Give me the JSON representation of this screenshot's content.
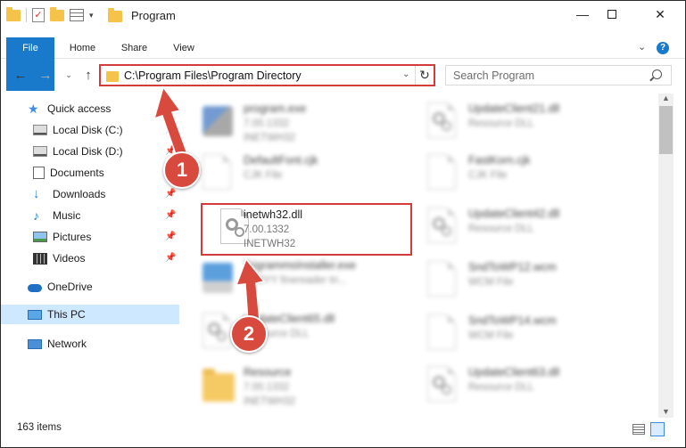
{
  "window": {
    "title": "Program",
    "minimize_glyph": "—",
    "close_glyph": "✕"
  },
  "qat": {
    "check_glyph": "✓",
    "caret": "▾"
  },
  "ribbon": {
    "tabs": [
      "File",
      "Home",
      "Share",
      "View"
    ],
    "expand_glyph": "⌄",
    "help_glyph": "?"
  },
  "nav": {
    "back_glyph": "←",
    "forward_glyph": "→",
    "recent_glyph": "⌄",
    "up_glyph": "↑"
  },
  "address": {
    "path": "C:\\Program Files\\Program Directory",
    "dropdown_glyph": "⌄",
    "refresh_glyph": "↻"
  },
  "search": {
    "placeholder": "Search Program"
  },
  "sidebar": {
    "pin_glyph": "📌",
    "items": [
      {
        "label": "Quick access",
        "icon": "star-icon"
      },
      {
        "label": "Local Disk (C:)",
        "icon": "drive-icon"
      },
      {
        "label": "Local Disk (D:)",
        "icon": "drive-icon"
      },
      {
        "label": "Documents",
        "icon": "documents-icon"
      },
      {
        "label": "Downloads",
        "icon": "download-icon"
      },
      {
        "label": "Music",
        "icon": "music-icon"
      },
      {
        "label": "Pictures",
        "icon": "pictures-icon"
      },
      {
        "label": "Videos",
        "icon": "videos-icon"
      },
      {
        "label": "OneDrive",
        "icon": "cloud-icon"
      },
      {
        "label": "This PC",
        "icon": "computer-icon"
      },
      {
        "label": "Network",
        "icon": "network-icon"
      }
    ]
  },
  "files": {
    "left": [
      {
        "name": "program.exe",
        "line2": "7.00.1332",
        "line3": "INETWH32",
        "icon": "exe-icon"
      },
      {
        "name": "DefaultFont.cjk",
        "line2": "CJK File",
        "line3": "",
        "icon": "file-icon"
      },
      {
        "name": "inetwh32.dll",
        "line2": "7.00.1332",
        "line3": "INETWH32",
        "icon": "dll-icon"
      },
      {
        "name": "TrigrammsInstaller.exe",
        "line2": "ABBYY finereader tri...",
        "line3": "",
        "icon": "exe-icon"
      },
      {
        "name": "UpdateClient65.dll",
        "line2": "Resource DLL",
        "line3": "",
        "icon": "dll-icon"
      },
      {
        "name": "Resource",
        "line2": "7.00.1332",
        "line3": "INETWH32",
        "icon": "folder-icon"
      }
    ],
    "right": [
      {
        "name": "UpdateClient21.dll",
        "line2": "Resource DLL",
        "line3": "",
        "icon": "dll-icon"
      },
      {
        "name": "FastKorn.cjk",
        "line2": "CJK File",
        "line3": "",
        "icon": "file-icon"
      },
      {
        "name": "UpdateClient42.dll",
        "line2": "Resource DLL",
        "line3": "",
        "icon": "dll-icon"
      },
      {
        "name": "SndToWP12.wcm",
        "line2": "WCM File",
        "line3": "",
        "icon": "file-icon"
      },
      {
        "name": "SndToWP14.wcm",
        "line2": "WCM File",
        "line3": "",
        "icon": "file-icon"
      },
      {
        "name": "UpdateClient63.dll",
        "line2": "Resource DLL",
        "line3": "",
        "icon": "dll-icon"
      }
    ]
  },
  "scrollbar": {
    "up_glyph": "▲",
    "down_glyph": "▼"
  },
  "status": {
    "item_count": "163 items"
  },
  "callouts": [
    "1",
    "2"
  ],
  "colors": {
    "accent": "#1979ca",
    "highlight": "#d43b3b",
    "badge": "#d94a3e",
    "selected": "#cde8ff"
  }
}
